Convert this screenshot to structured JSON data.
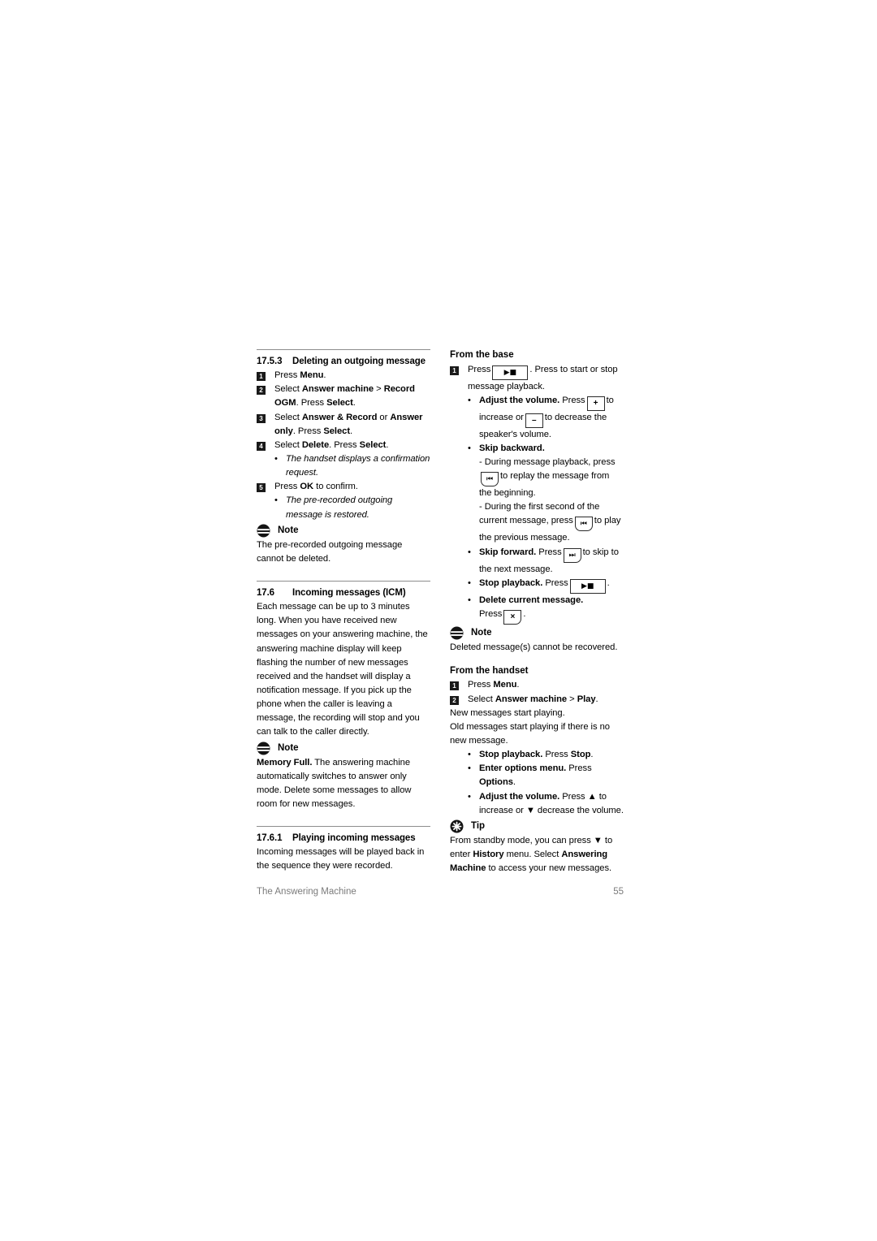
{
  "document": {
    "footer_section": "The Answering Machine",
    "page_number": "55"
  },
  "left_column": {
    "section_17_5_3": {
      "number": "17.5.3",
      "title": "Deleting an outgoing message",
      "steps": [
        {
          "badge": "1",
          "html": "Press <b>Menu</b>."
        },
        {
          "badge": "2",
          "html": "Select <b>Answer machine</b> &gt; <b>Record OGM</b>. Press <b>Select</b>."
        },
        {
          "badge": "3",
          "html": "Select <b>Answer &amp; Record</b> or <b>Answer only</b>. Press <b>Select</b>."
        },
        {
          "badge": "4",
          "html": "Select <b>Delete</b>. Press <b>Select</b>."
        }
      ],
      "bullet_after_step4": "The handset displays a confirmation request.",
      "step5": {
        "badge": "5",
        "html": "Press <b>OK</b> to confirm."
      },
      "bullet_after_step5": "The pre-recorded outgoing message is restored."
    },
    "note_1": {
      "icon": "note-icon",
      "title": "Note",
      "body": "The pre-recorded outgoing message cannot be deleted."
    },
    "section_17_6": {
      "number": "17.6",
      "title": "Incoming messages (ICM)",
      "body": "Each message can be up to 3 minutes long. When you have received new messages on your answering machine, the answering machine display will keep flashing the number of new messages received and the handset will display a notification message. If you pick up the phone when the caller is leaving a message, the recording will stop and you can talk to the caller directly."
    },
    "note_2": {
      "icon": "note-icon",
      "title": "Note",
      "body_html": "<b>Memory Full.</b> The answering machine automatically switches to answer only mode. Delete some messages to allow room for new messages."
    },
    "section_17_6_1": {
      "number": "17.6.1",
      "title": "Playing incoming messages",
      "body": "Incoming messages will be played back in the sequence they were recorded."
    }
  },
  "right_column": {
    "from_the_base": {
      "heading": "From the base",
      "step1_badge": "1",
      "step1_pre": "Press",
      "step1_key": "play-stop-key",
      "step1_post": ". Press to start or stop message playback.",
      "bullets": {
        "adjust_volume": {
          "label": "Adjust the volume.",
          "text_1": " Press",
          "key_increase": "plus-key",
          "text_2": "to increase or",
          "key_decrease": "minus-key",
          "text_3": "to decrease the speaker's volume."
        },
        "skip_backward": {
          "label": "Skip backward.",
          "dash_1_pre": "- During message playback, press",
          "dash_1_key": "skip-backward-key",
          "dash_1_post": "to replay the message from the beginning.",
          "dash_2_pre": "- During the first second of the current message, press",
          "dash_2_key": "skip-backward-key",
          "dash_2_post": "to play the previous message."
        },
        "skip_forward": {
          "label": "Skip forward.",
          "pre": " Press",
          "key": "skip-forward-key",
          "post": "to skip to the next message."
        },
        "stop_playback": {
          "label": "Stop playback.",
          "pre": " Press",
          "key": "play-stop-key",
          "post": "."
        },
        "delete_current": {
          "label": "Delete current message.",
          "pre": "Press",
          "key": "delete-x-key",
          "post": "."
        }
      }
    },
    "note_3": {
      "icon": "note-icon",
      "title": "Note",
      "body": "Deleted message(s) cannot be recovered."
    },
    "from_the_handset": {
      "heading": "From the handset",
      "steps": [
        {
          "badge": "1",
          "html": "Press <b>Menu</b>."
        },
        {
          "badge": "2",
          "html": "Select <b>Answer machine</b> &gt; <b>Play</b>."
        }
      ],
      "para_1": "New messages start playing.",
      "para_2": "Old messages start playing if there is no new message.",
      "bullets": [
        {
          "label": "Stop playback.",
          "rest_html": " Press <b>Stop</b>."
        },
        {
          "label": "Enter options menu.",
          "rest_html": " Press <b>Options</b>."
        },
        {
          "label": "Adjust the volume.",
          "rest_html": " Press ▲ to increase or ▼ decrease the volume."
        }
      ]
    },
    "tip": {
      "icon": "tip-icon",
      "title": "Tip",
      "body_html": "From standby mode, you can press ▼ to enter <b>History</b> menu. Select <b>Answering Machine</b> to access your new messages."
    }
  },
  "colors": {
    "text": "#000000",
    "rule": "#8d8d8d",
    "footer_text": "#7b7b7b",
    "badge_bg": "#1a1a1a",
    "badge_text": "#ffffff"
  }
}
